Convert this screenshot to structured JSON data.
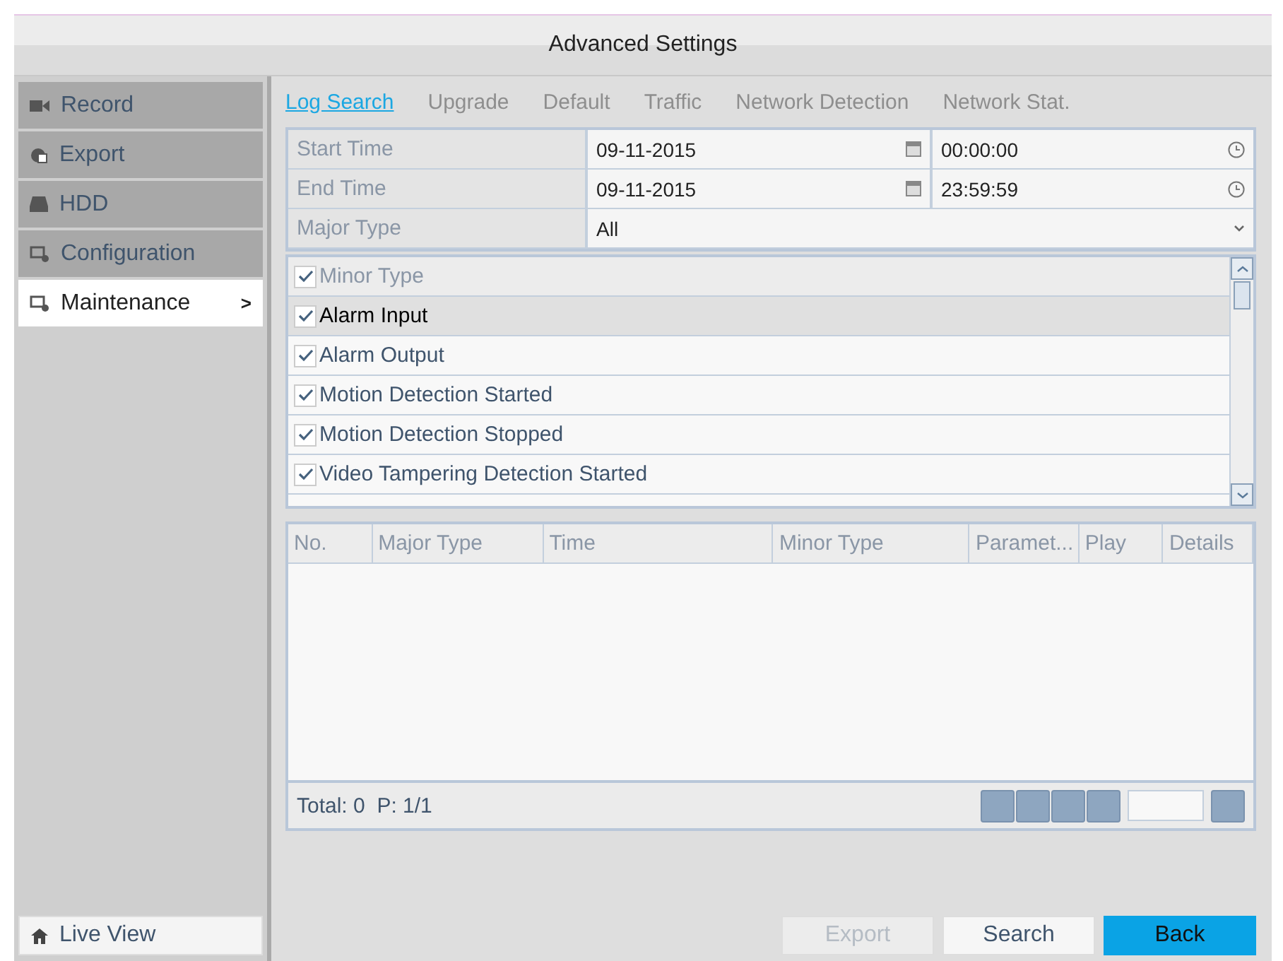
{
  "window": {
    "title": "Advanced Settings"
  },
  "sidebar": {
    "items": [
      {
        "label": "Record",
        "selected": false
      },
      {
        "label": "Export",
        "selected": false
      },
      {
        "label": "HDD",
        "selected": false
      },
      {
        "label": "Configuration",
        "selected": false
      },
      {
        "label": "Maintenance",
        "selected": true,
        "arrow": ">"
      }
    ],
    "live_view": {
      "label": "Live View"
    }
  },
  "tabs": [
    {
      "label": "Log Search",
      "selected": true
    },
    {
      "label": "Upgrade",
      "selected": false
    },
    {
      "label": "Default",
      "selected": false
    },
    {
      "label": "Traffic",
      "selected": false
    },
    {
      "label": "Network Detection",
      "selected": false
    },
    {
      "label": "Network Stat.",
      "selected": false
    }
  ],
  "form": {
    "start_time": {
      "label": "Start Time",
      "date": "09-11-2015",
      "time": "00:00:00"
    },
    "end_time": {
      "label": "End Time",
      "date": "09-11-2015",
      "time": "23:59:59"
    },
    "major_type": {
      "label": "Major Type",
      "value": "All"
    }
  },
  "minor_types": [
    {
      "kind": "header",
      "label": "Minor Type",
      "checked": true,
      "selected": false
    },
    {
      "kind": "item",
      "label": "Alarm Input",
      "checked": true,
      "selected": true
    },
    {
      "kind": "item",
      "label": "Alarm Output",
      "checked": true,
      "selected": false
    },
    {
      "kind": "item",
      "label": "Motion Detection Started",
      "checked": true,
      "selected": false
    },
    {
      "kind": "item",
      "label": "Motion Detection Stopped",
      "checked": true,
      "selected": false
    },
    {
      "kind": "item",
      "label": "Video Tampering Detection Started",
      "checked": true,
      "selected": false
    }
  ],
  "table": {
    "columns": [
      "No.",
      "Major Type",
      "Time",
      "Minor Type",
      "Paramet...",
      "Play",
      "Details"
    ]
  },
  "status": "Total: 0  P: 1/1",
  "buttons": [
    {
      "label": "Export",
      "kind": "normal",
      "disabled": true
    },
    {
      "label": "Search",
      "kind": "normal",
      "disabled": false
    },
    {
      "label": "Back",
      "kind": "primary",
      "disabled": false
    }
  ]
}
